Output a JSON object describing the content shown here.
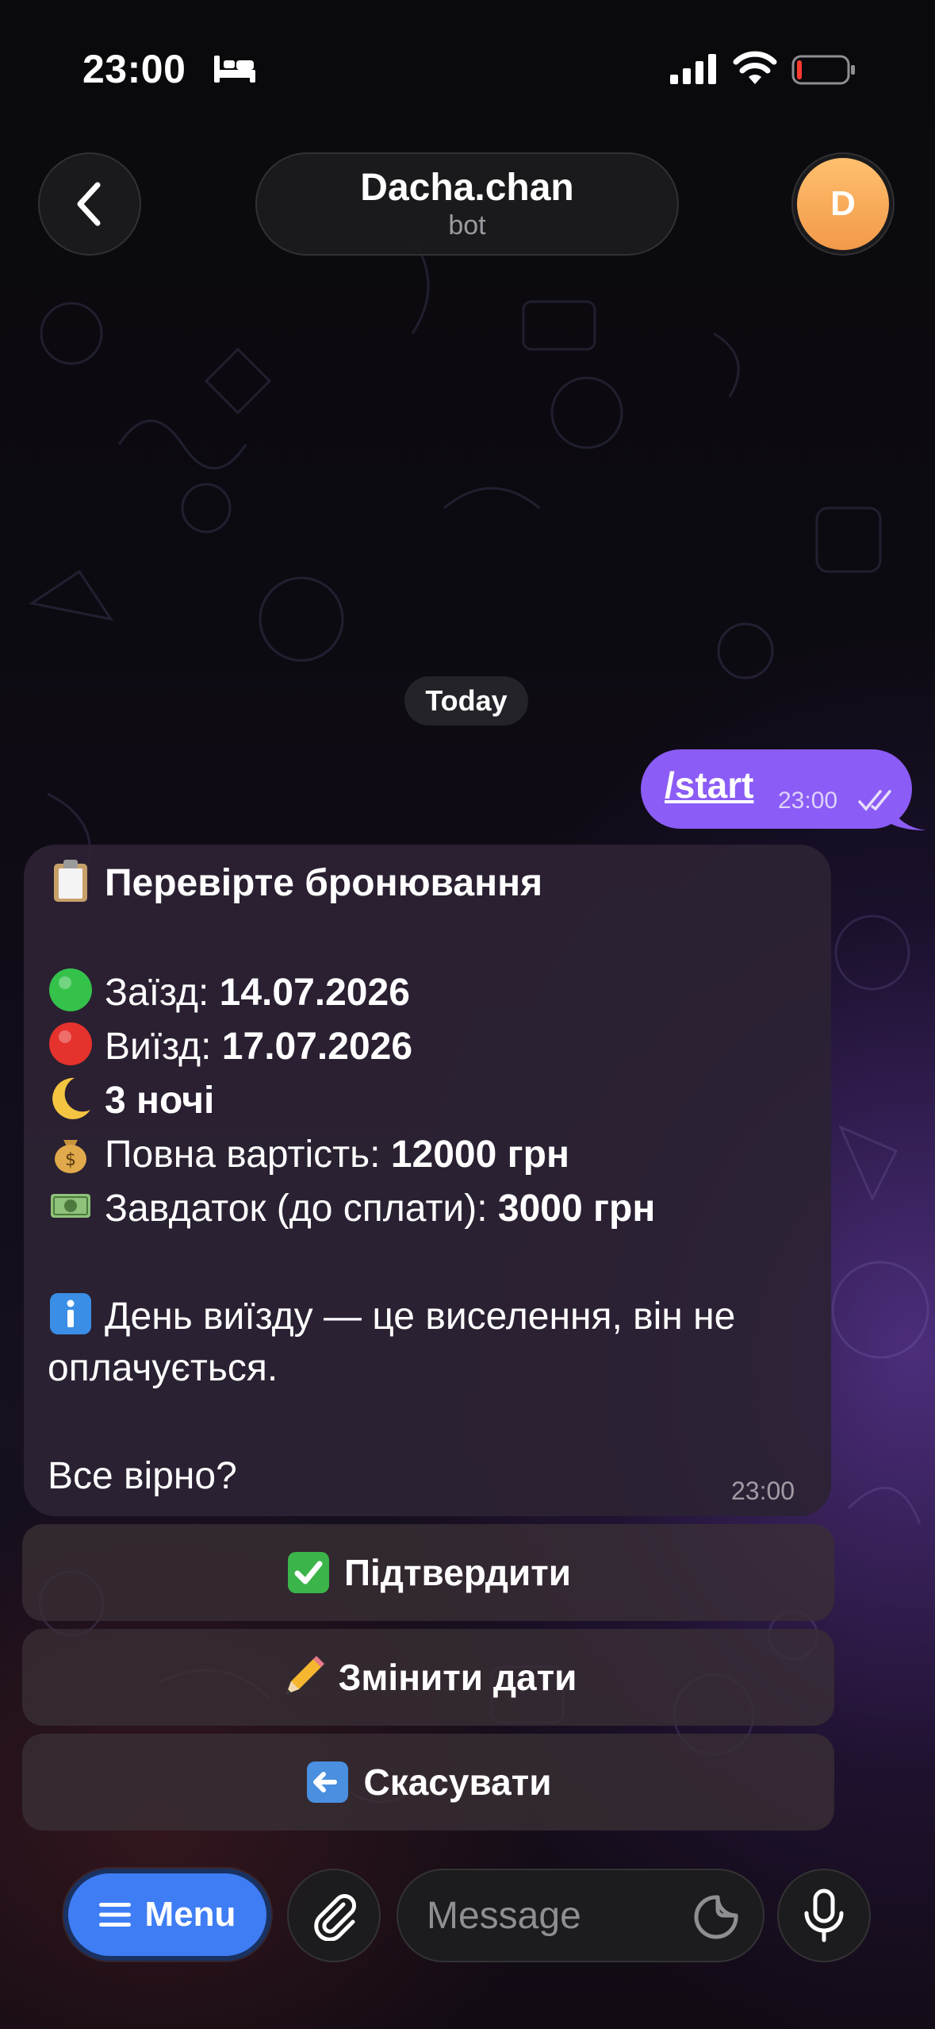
{
  "status_bar": {
    "time": "23:00"
  },
  "header": {
    "title": "Dacha.chan",
    "subtitle": "bot",
    "avatar_letter": "D"
  },
  "date_chip": "Today",
  "outgoing": {
    "text": "/start",
    "time": "23:00"
  },
  "incoming": {
    "title": "Перевірте бронювання",
    "checkin_label": "Заїзд: ",
    "checkin_value": "14.07.2026",
    "checkout_label": "Виїзд: ",
    "checkout_value": "17.07.2026",
    "nights": "3 ночі",
    "total_label": "Повна вартість: ",
    "total_value": "12000 грн",
    "deposit_label": "Завдаток (до сплати): ",
    "deposit_value": "3000 грн",
    "info_line1": "День виїзду — це виселення, він не",
    "info_line2": "оплачується.",
    "question": "Все вірно?",
    "time": "23:00"
  },
  "buttons": {
    "confirm": "Підтвердити",
    "change_dates": "Змінити дати",
    "cancel": "Скасувати"
  },
  "bottom_bar": {
    "menu_label": "Menu",
    "input_placeholder": "Message"
  },
  "colors": {
    "accent": "#8b5cf6",
    "menu_blue": "#3f7df4",
    "avatar_orange": "#f2994a"
  }
}
